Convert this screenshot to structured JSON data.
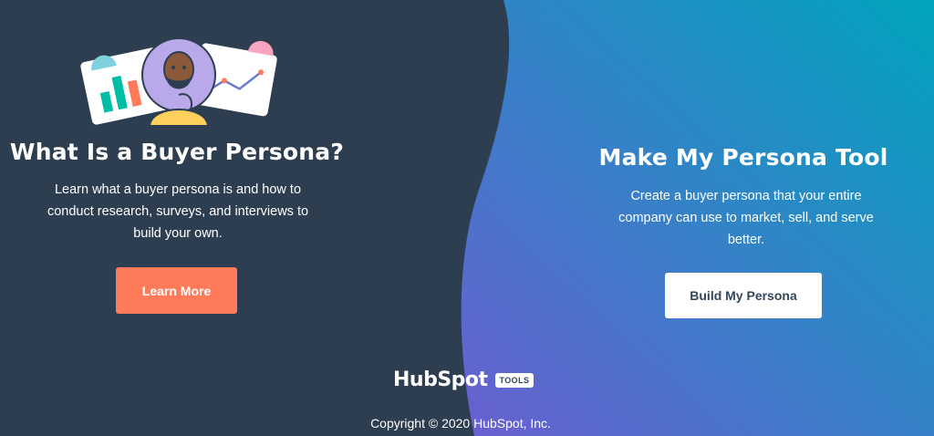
{
  "colors": {
    "left_bg": "#2d3e50",
    "right_gradient_start": "#6a5fd1",
    "right_gradient_end": "#00a4bd",
    "primary_button": "#ff7a59",
    "secondary_button": "#ffffff",
    "text_dark": "#33475b"
  },
  "left": {
    "illustration_icon": "persona-thinking-with-charts-icon",
    "title": "What Is a Buyer Persona?",
    "description": "Learn what a buyer persona is and how to conduct research, surveys, and interviews to build your own.",
    "button_label": "Learn More"
  },
  "right": {
    "illustration_icon": "three-personas-avatars-icon",
    "title": "Make My Persona Tool",
    "description": "Create a buyer persona that your entire company can use to market, sell, and serve better.",
    "button_label": "Build My Persona"
  },
  "footer": {
    "brand_name": "HubSpot",
    "brand_tag": "TOOLS",
    "copyright": "Copyright © 2020 HubSpot, Inc."
  }
}
